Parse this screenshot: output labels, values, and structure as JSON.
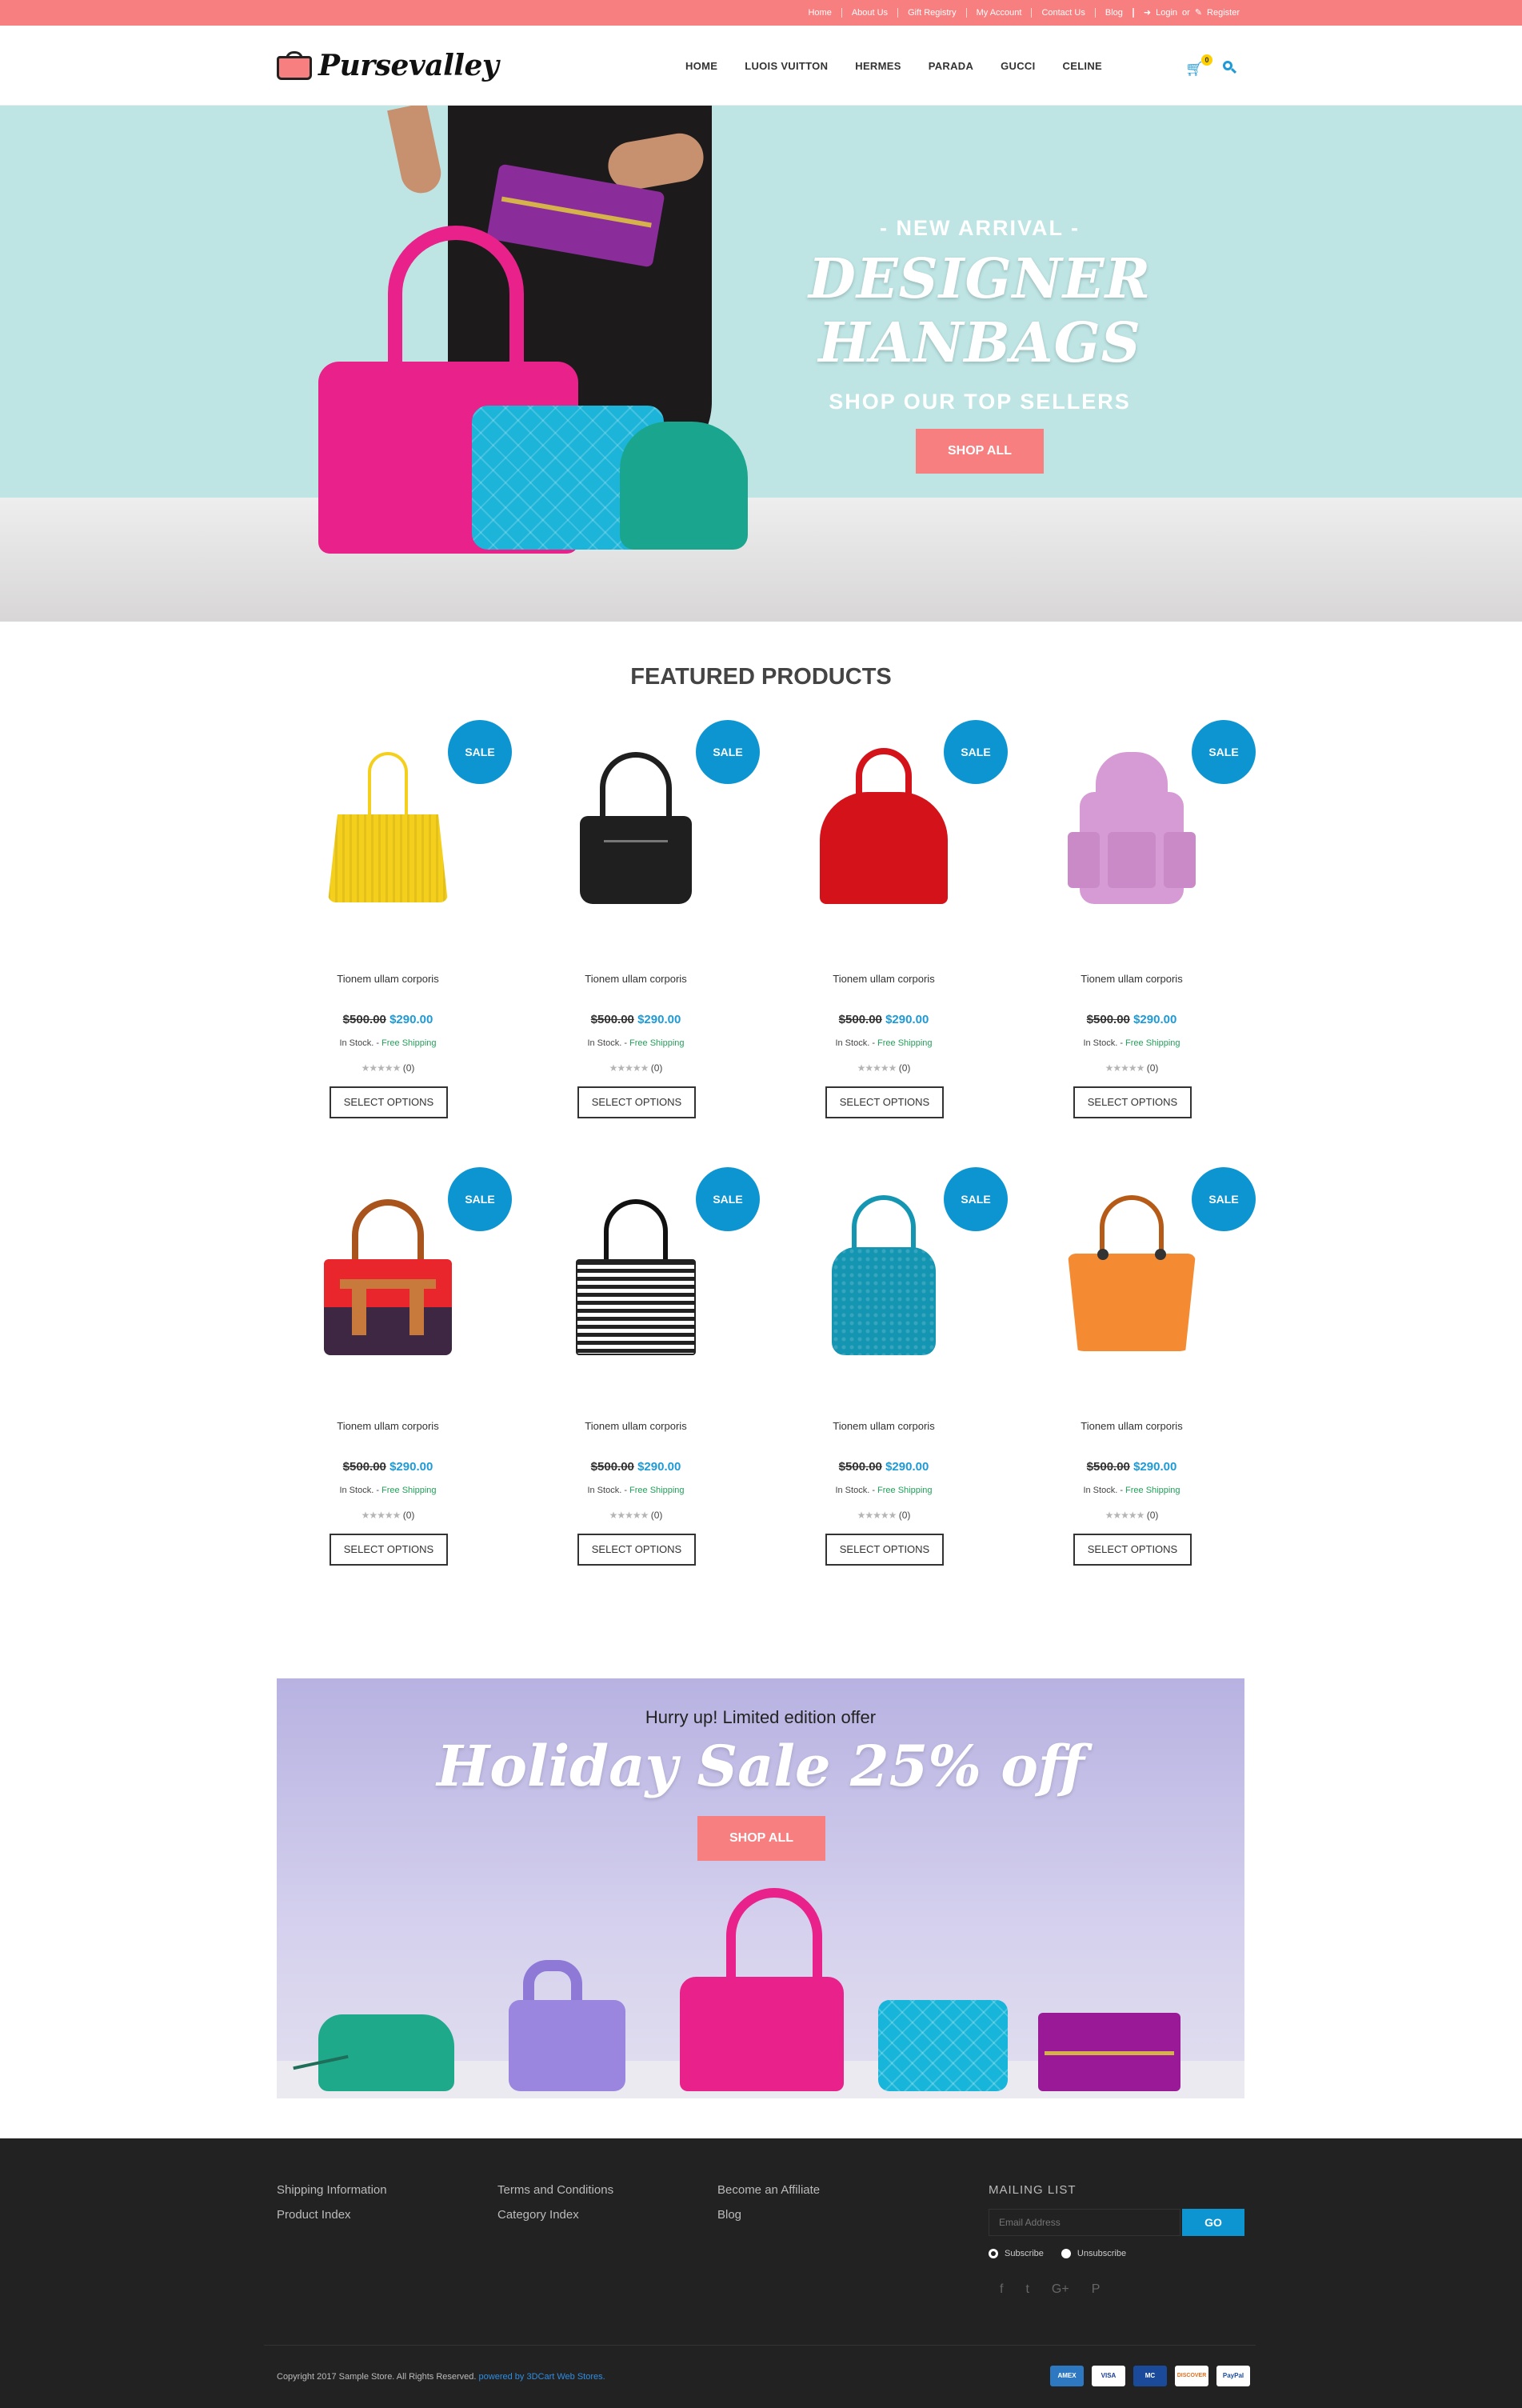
{
  "topbar": {
    "links": [
      "Home",
      "About Us",
      "Gift Registry",
      "My Account",
      "Contact Us",
      "Blog"
    ],
    "login": "Login",
    "or": "or",
    "register": "Register",
    "color": "#f77f80"
  },
  "header": {
    "logo": "Pursevalley",
    "nav": [
      "HOME",
      "LUOIS VUITTON",
      "HERMES",
      "PARADA",
      "GUCCI",
      "CELINE"
    ],
    "cart_count": "0",
    "accent": "#1e9ad6"
  },
  "hero": {
    "pre_title": "- NEW ARRIVAL -",
    "title": "DESIGNER HANBAGS",
    "subtitle": "SHOP OUR TOP SELLERS",
    "button": "SHOP ALL"
  },
  "featured": {
    "title": "FEATURED PRODUCTS",
    "products": [
      {
        "sale": "SALE",
        "name": "Tionem ullam corporis",
        "old_price": "$500.00",
        "new_price": "$290.00",
        "stock": "In Stock.",
        "sep": "-",
        "shipping": "Free Shipping",
        "stars": "★★★★★",
        "reviews": "(0)",
        "button": "SELECT OPTIONS",
        "color": "#f4cf1c",
        "icon": "yellow-tote-icon"
      },
      {
        "sale": "SALE",
        "name": "Tionem ullam corporis",
        "old_price": "$500.00",
        "new_price": "$290.00",
        "stock": "In Stock.",
        "sep": "-",
        "shipping": "Free Shipping",
        "stars": "★★★★★",
        "reviews": "(0)",
        "button": "SELECT OPTIONS",
        "color": "#1f1f1f",
        "icon": "black-handbag-icon"
      },
      {
        "sale": "SALE",
        "name": "Tionem ullam corporis",
        "old_price": "$500.00",
        "new_price": "$290.00",
        "stock": "In Stock.",
        "sep": "-",
        "shipping": "Free Shipping",
        "stars": "★★★★★",
        "reviews": "(0)",
        "button": "SELECT OPTIONS",
        "color": "#d4121a",
        "icon": "red-handbag-icon"
      },
      {
        "sale": "SALE",
        "name": "Tionem ullam corporis",
        "old_price": "$500.00",
        "new_price": "$290.00",
        "stock": "In Stock.",
        "sep": "-",
        "shipping": "Free Shipping",
        "stars": "★★★★★",
        "reviews": "(0)",
        "button": "SELECT OPTIONS",
        "color": "#d69ad4",
        "icon": "pink-backpack-icon"
      },
      {
        "sale": "SALE",
        "name": "Tionem ullam corporis",
        "old_price": "$500.00",
        "new_price": "$290.00",
        "stock": "In Stock.",
        "sep": "-",
        "shipping": "Free Shipping",
        "stars": "★★★★★",
        "reviews": "(0)",
        "button": "SELECT OPTIONS",
        "color": "#e8262b",
        "icon": "multicolor-handbag-icon"
      },
      {
        "sale": "SALE",
        "name": "Tionem ullam corporis",
        "old_price": "$500.00",
        "new_price": "$290.00",
        "stock": "In Stock.",
        "sep": "-",
        "shipping": "Free Shipping",
        "stars": "★★★★★",
        "reviews": "(0)",
        "button": "SELECT OPTIONS",
        "color": "#444444",
        "icon": "striped-tote-icon"
      },
      {
        "sale": "SALE",
        "name": "Tionem ullam corporis",
        "old_price": "$500.00",
        "new_price": "$290.00",
        "stock": "In Stock.",
        "sep": "-",
        "shipping": "Free Shipping",
        "stars": "★★★★★",
        "reviews": "(0)",
        "button": "SELECT OPTIONS",
        "color": "#1495b2",
        "icon": "teal-bag-icon"
      },
      {
        "sale": "SALE",
        "name": "Tionem ullam corporis",
        "old_price": "$500.00",
        "new_price": "$290.00",
        "stock": "In Stock.",
        "sep": "-",
        "shipping": "Free Shipping",
        "stars": "★★★★★",
        "reviews": "(0)",
        "button": "SELECT OPTIONS",
        "color": "#f48a32",
        "icon": "orange-handbag-icon"
      }
    ]
  },
  "promo": {
    "hurry": "Hurry up!  Limited edition offer",
    "title": "Holiday Sale 25% off",
    "button": "SHOP ALL"
  },
  "footer": {
    "col1": [
      "Shipping Information",
      "Product Index"
    ],
    "col2": [
      "Terms and Conditions",
      "Category Index"
    ],
    "col3": [
      "Become an Affiliate",
      "Blog"
    ],
    "mailing_title": "MAILING LIST",
    "email_placeholder": "Email Address",
    "go": "GO",
    "subscribe": "Subscribe",
    "unsubscribe": "Unsubscribe",
    "social": [
      "f",
      "t",
      "G+",
      "P"
    ],
    "copyright": "Copyright 2017 Sample Store. All Rights Reserved.",
    "powered": "powered by 3DCart Web Stores.",
    "payments": [
      "AMEX",
      "VISA",
      "MC",
      "DISCOVER",
      "PayPal"
    ]
  }
}
